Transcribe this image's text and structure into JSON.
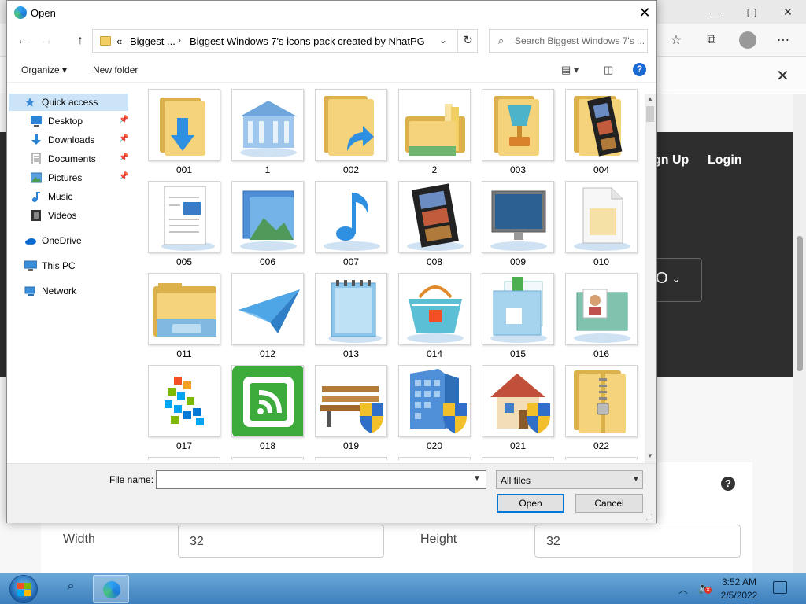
{
  "dialog": {
    "title": "Open",
    "close_glyph": "✕",
    "nav": {
      "back": "←",
      "forward": "→",
      "up": "↑"
    },
    "address": {
      "overflow": "«",
      "crumbs": [
        "Biggest ...",
        "Biggest Windows 7's icons pack created by NhatPG"
      ],
      "separator": "›",
      "dropdown": "⌄",
      "refresh": "↻"
    },
    "search": {
      "placeholder": "Search Biggest Windows 7's ..."
    },
    "toolbar": {
      "organize": "Organize ▾",
      "new_folder": "New folder",
      "help": "?"
    },
    "sidebar": [
      {
        "label": "Quick access",
        "icon": "star-icon",
        "selected": true
      },
      {
        "label": "Desktop",
        "icon": "desktop-icon",
        "pinned": true
      },
      {
        "label": "Downloads",
        "icon": "download-icon",
        "pinned": true
      },
      {
        "label": "Documents",
        "icon": "documents-icon",
        "pinned": true
      },
      {
        "label": "Pictures",
        "icon": "pictures-icon",
        "pinned": true
      },
      {
        "label": "Music",
        "icon": "music-icon"
      },
      {
        "label": "Videos",
        "icon": "videos-icon"
      },
      {
        "label": "OneDrive",
        "icon": "cloud-icon"
      },
      {
        "label": "This PC",
        "icon": "computer-icon"
      },
      {
        "label": "Network",
        "icon": "network-icon"
      }
    ],
    "files": [
      {
        "name": "001",
        "icon": "folder-download-icon"
      },
      {
        "name": "1",
        "icon": "bank-building-icon"
      },
      {
        "name": "002",
        "icon": "folder-shortcut-icon"
      },
      {
        "name": "2",
        "icon": "folder-stack-icon"
      },
      {
        "name": "003",
        "icon": "folder-trophy-icon"
      },
      {
        "name": "004",
        "icon": "folder-filmstrip-icon"
      },
      {
        "name": "005",
        "icon": "document-icon"
      },
      {
        "name": "006",
        "icon": "pictures-icon"
      },
      {
        "name": "007",
        "icon": "music-note-icon"
      },
      {
        "name": "008",
        "icon": "filmstrip-icon"
      },
      {
        "name": "009",
        "icon": "monitor-icon"
      },
      {
        "name": "010",
        "icon": "blank-file-icon"
      },
      {
        "name": "011",
        "icon": "explorer-folder-icon"
      },
      {
        "name": "012",
        "icon": "paper-plane-icon"
      },
      {
        "name": "013",
        "icon": "notepad-icon"
      },
      {
        "name": "014",
        "icon": "shopping-basket-icon"
      },
      {
        "name": "015",
        "icon": "mail-folder-icon"
      },
      {
        "name": "016",
        "icon": "contact-card-icon"
      },
      {
        "name": "017",
        "icon": "tiles-icon"
      },
      {
        "name": "018",
        "icon": "feed-green-icon"
      },
      {
        "name": "019",
        "icon": "bench-shield-icon"
      },
      {
        "name": "020",
        "icon": "building-shield-icon"
      },
      {
        "name": "021",
        "icon": "house-shield-icon"
      },
      {
        "name": "022",
        "icon": "zip-folder-icon"
      }
    ],
    "bottom": {
      "file_name_label": "File name:",
      "file_name_value": "",
      "file_type": "All files",
      "open_label": "Open",
      "cancel_label": "Cancel"
    }
  },
  "browser": {
    "window": {
      "minimize": "—",
      "maximize": "▢",
      "close": "✕"
    },
    "toolbar_icons": [
      "favorites-icon",
      "collections-icon",
      "profile-icon",
      "more-icon"
    ],
    "site": {
      "signup": "gn Up",
      "login": "Login",
      "lang_partial": "O"
    },
    "form": {
      "width_label": "Width",
      "width_value": "32",
      "height_label": "Height",
      "height_value": "32",
      "help": "?"
    }
  },
  "taskbar": {
    "time": "3:52 AM",
    "date": "2/5/2022"
  },
  "colors": {
    "accent": "#0078d7",
    "selection": "#cce4f7",
    "folder": "#f2cf63",
    "taskbar": "#4a8cc8"
  }
}
